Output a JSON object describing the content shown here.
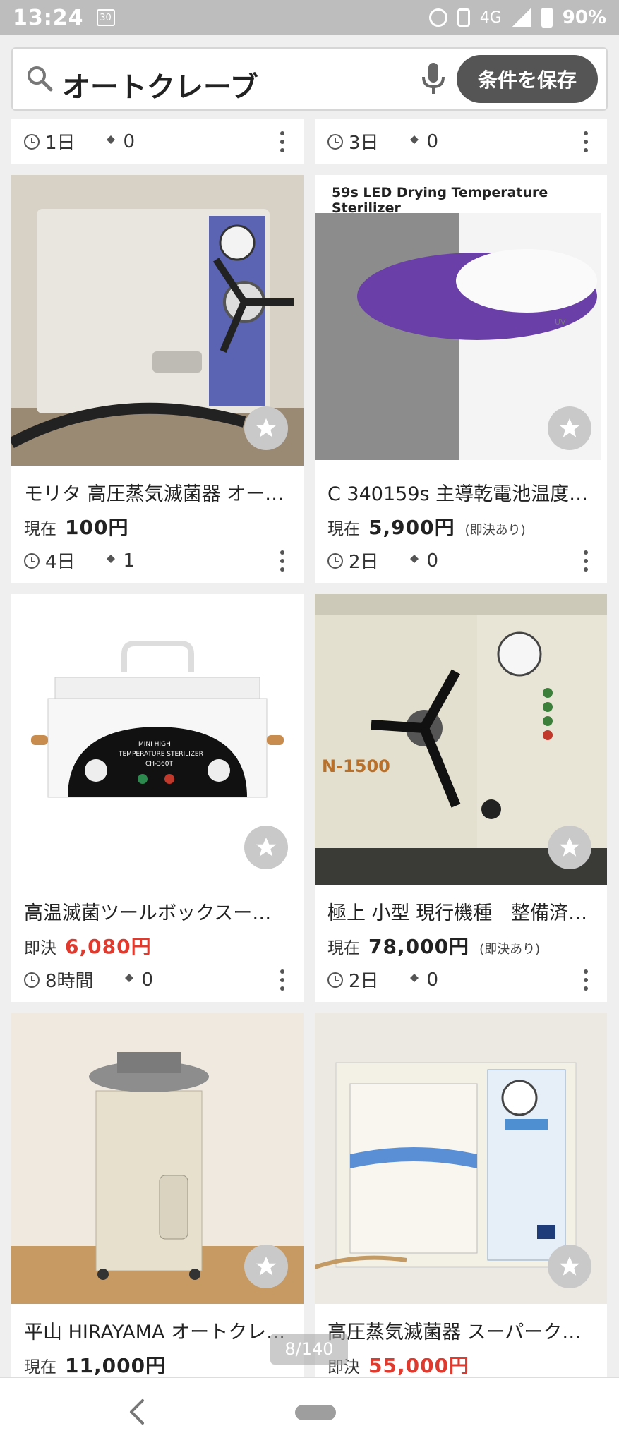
{
  "status": {
    "time": "13:24",
    "calendar": "30",
    "network": "4G",
    "battery": "90%"
  },
  "search": {
    "query": "オートクレーブ",
    "save_label": "条件を保存"
  },
  "top_cards": [
    {
      "time": "1日",
      "bids": "0"
    },
    {
      "time": "3日",
      "bids": "0"
    }
  ],
  "listings": [
    {
      "title": "モリタ 高圧蒸気滅菌器 オー…",
      "price_label": "現在",
      "price": "100円",
      "price_note": "",
      "time": "4日",
      "bids": "1",
      "price_color": "#222222"
    },
    {
      "title": "C 340159s 主導乾電池温度…",
      "price_label": "現在",
      "price": "5,900円",
      "price_note": "(即決あり)",
      "time": "2日",
      "bids": "0",
      "price_color": "#222222",
      "image_caption": "59s LED Drying Temperature Sterilizer"
    },
    {
      "title": "高温滅菌ツールボックスー…",
      "price_label": "即決",
      "price": "6,080円",
      "price_note": "",
      "time": "8時間",
      "bids": "0",
      "price_color": "#e03a2e",
      "image_caption_1": "MINI HIGH",
      "image_caption_2": "TEMPERATURE STERILIZER",
      "image_caption_3": "CH-360T"
    },
    {
      "title": "極上 小型 現行機種　整備済…",
      "price_label": "現在",
      "price": "78,000円",
      "price_note": "(即決あり)",
      "time": "2日",
      "bids": "0",
      "price_color": "#222222",
      "image_caption": "N-1500"
    },
    {
      "title": "平山 HIRAYAMA オートクレ…",
      "price_label": "現在",
      "price": "11,000円",
      "price_note": ""
    },
    {
      "title": "高圧蒸気滅菌器 スーパーク…",
      "price_label": "即決",
      "price": "55,000円",
      "price_note": "",
      "price_color": "#e03a2e"
    }
  ],
  "pager": "8/140"
}
